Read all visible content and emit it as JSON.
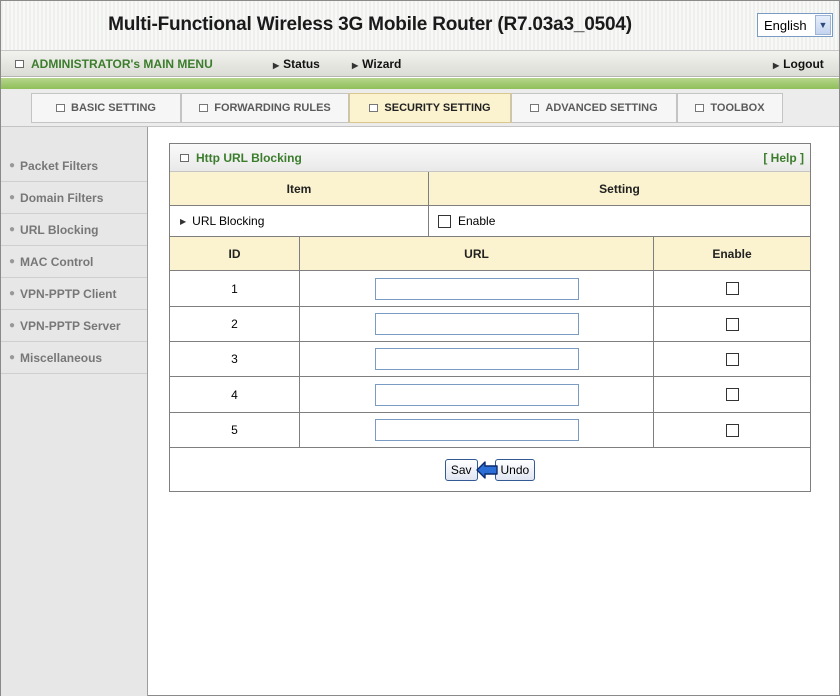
{
  "title": "Multi-Functional Wireless 3G Mobile Router (R7.03a3_0504)",
  "language": {
    "selected": "English"
  },
  "menubar": {
    "admin_label": "ADMINISTRATOR's MAIN MENU",
    "status": "Status",
    "wizard": "Wizard",
    "logout": "Logout"
  },
  "tabs": [
    {
      "label": "BASIC SETTING"
    },
    {
      "label": "FORWARDING RULES"
    },
    {
      "label": "SECURITY SETTING",
      "active": true
    },
    {
      "label": "ADVANCED SETTING"
    },
    {
      "label": "TOOLBOX"
    }
  ],
  "sidebar": {
    "items": [
      {
        "label": "Packet Filters"
      },
      {
        "label": "Domain Filters"
      },
      {
        "label": "URL Blocking"
      },
      {
        "label": "MAC Control"
      },
      {
        "label": "VPN-PPTP Client"
      },
      {
        "label": "VPN-PPTP Server"
      },
      {
        "label": "Miscellaneous"
      }
    ]
  },
  "panel": {
    "title": "Http URL Blocking",
    "help": "[ Help ]",
    "header_item": "Item",
    "header_setting": "Setting",
    "url_blocking_label": "URL Blocking",
    "enable_label": "Enable",
    "col_id": "ID",
    "col_url": "URL",
    "col_enable": "Enable",
    "rows": [
      {
        "id": "1",
        "url": "",
        "enabled": false
      },
      {
        "id": "2",
        "url": "",
        "enabled": false
      },
      {
        "id": "3",
        "url": "",
        "enabled": false
      },
      {
        "id": "4",
        "url": "",
        "enabled": false
      },
      {
        "id": "5",
        "url": "",
        "enabled": false
      }
    ],
    "save_label": "Sav",
    "undo_label": "Undo"
  },
  "colors": {
    "accent_green": "#3c7d2d",
    "header_yellow": "#fbf3cf",
    "stripe_green": "#9fc96c"
  }
}
